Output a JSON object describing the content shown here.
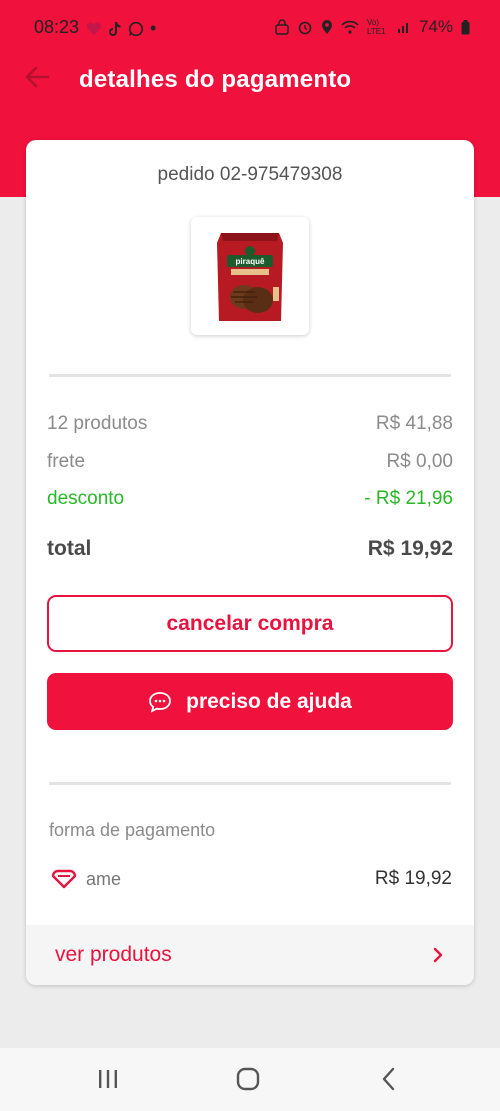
{
  "status_bar": {
    "time": "08:23",
    "battery": "74%",
    "network": "Vo) LTE1"
  },
  "header": {
    "title": "detalhes do pagamento"
  },
  "order": {
    "number": "pedido 02-975479308",
    "product_image_brand": "piraquê"
  },
  "summary": {
    "products_label": "12 produtos",
    "products_value": "R$ 41,88",
    "shipping_label": "frete",
    "shipping_value": "R$ 0,00",
    "discount_label": "desconto",
    "discount_value": "- R$ 21,96",
    "total_label": "total",
    "total_value": "R$ 19,92"
  },
  "actions": {
    "cancel_label": "cancelar compra",
    "help_label": "preciso de ajuda"
  },
  "payment": {
    "section_label": "forma de pagamento",
    "method": "ame",
    "amount": "R$ 19,92"
  },
  "footer": {
    "see_products_label": "ver produtos"
  },
  "colors": {
    "brand_red": "#f0113d",
    "discount_green": "#28b828"
  }
}
